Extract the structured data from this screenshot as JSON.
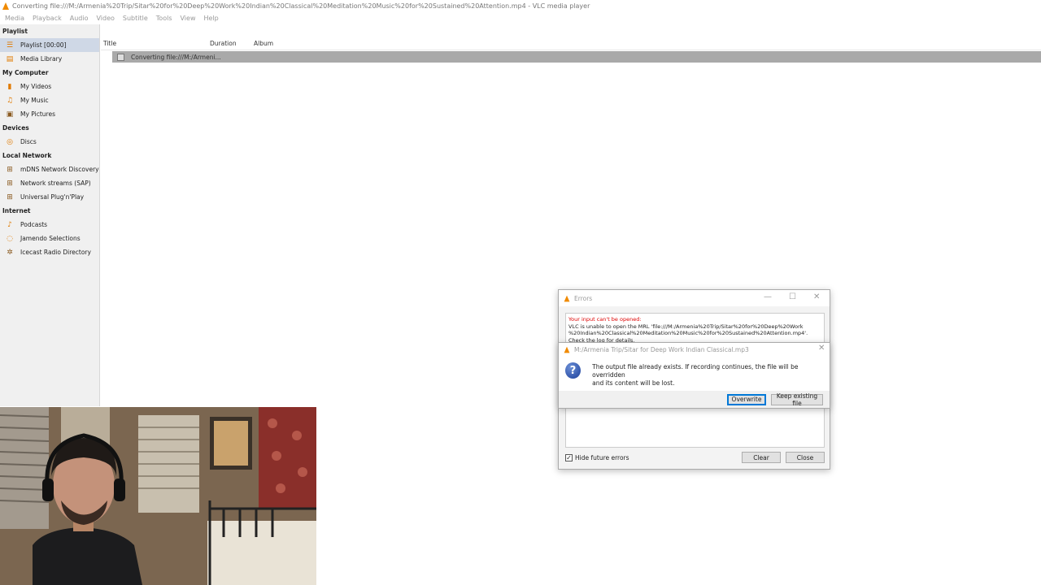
{
  "window": {
    "title": "Converting file:///M:/Armenia%20Trip/Sitar%20for%20Deep%20Work%20Indian%20Classical%20Meditation%20Music%20for%20Sustained%20Attention.mp4 - VLC media player"
  },
  "menu": [
    "Media",
    "Playback",
    "Audio",
    "Video",
    "Subtitle",
    "Tools",
    "View",
    "Help"
  ],
  "sidebar": {
    "sections": [
      {
        "header": "Playlist",
        "items": [
          {
            "label": "Playlist [00:00]",
            "icon": "playlist-icon",
            "selected": true
          },
          {
            "label": "Media Library",
            "icon": "media-library-icon"
          }
        ]
      },
      {
        "header": "My Computer",
        "items": [
          {
            "label": "My Videos",
            "icon": "videos-icon"
          },
          {
            "label": "My Music",
            "icon": "music-icon"
          },
          {
            "label": "My Pictures",
            "icon": "pictures-icon"
          }
        ]
      },
      {
        "header": "Devices",
        "items": [
          {
            "label": "Discs",
            "icon": "disc-icon"
          }
        ]
      },
      {
        "header": "Local Network",
        "items": [
          {
            "label": "mDNS Network Discovery",
            "icon": "network-icon"
          },
          {
            "label": "Network streams (SAP)",
            "icon": "network-icon"
          },
          {
            "label": "Universal Plug'n'Play",
            "icon": "network-icon"
          }
        ]
      },
      {
        "header": "Internet",
        "items": [
          {
            "label": "Podcasts",
            "icon": "podcast-icon"
          },
          {
            "label": "Jamendo Selections",
            "icon": "jamendo-icon"
          },
          {
            "label": "Icecast Radio Directory",
            "icon": "radio-icon"
          }
        ]
      }
    ]
  },
  "playlist": {
    "columns": [
      "Title",
      "Duration",
      "Album"
    ],
    "rows": [
      {
        "title": "Converting file:///M:/Armeni..."
      }
    ]
  },
  "errors_dialog": {
    "title": "Errors",
    "error_heading": "Your input can't be opened:",
    "error_line1": "VLC is unable to open the MRL 'file:///M:/Armenia%20Trip/Sitar%20for%20Deep%20Work",
    "error_line2": "%20Indian%20Classical%20Meditation%20Music%20for%20Sustained%20Attention.mp4'.",
    "error_line3": "Check the log for details.",
    "hide_future_errors_label": "Hide future errors",
    "hide_future_errors_checked": true,
    "clear_label": "Clear",
    "close_label": "Close"
  },
  "confirm_dialog": {
    "title": "M:/Armenia Trip/Sitar for Deep Work Indian Classical.mp3",
    "message_line1": "The output file already exists. If recording continues, the file will be overridden",
    "message_line2": "and its content will be lost.",
    "overwrite_label": "Overwrite",
    "keep_label": "Keep existing file"
  },
  "colors": {
    "accent": "#0078d7",
    "vlc_orange": "#f08a00",
    "error_red": "#d00000",
    "selected_row": "#a9a9a9"
  }
}
